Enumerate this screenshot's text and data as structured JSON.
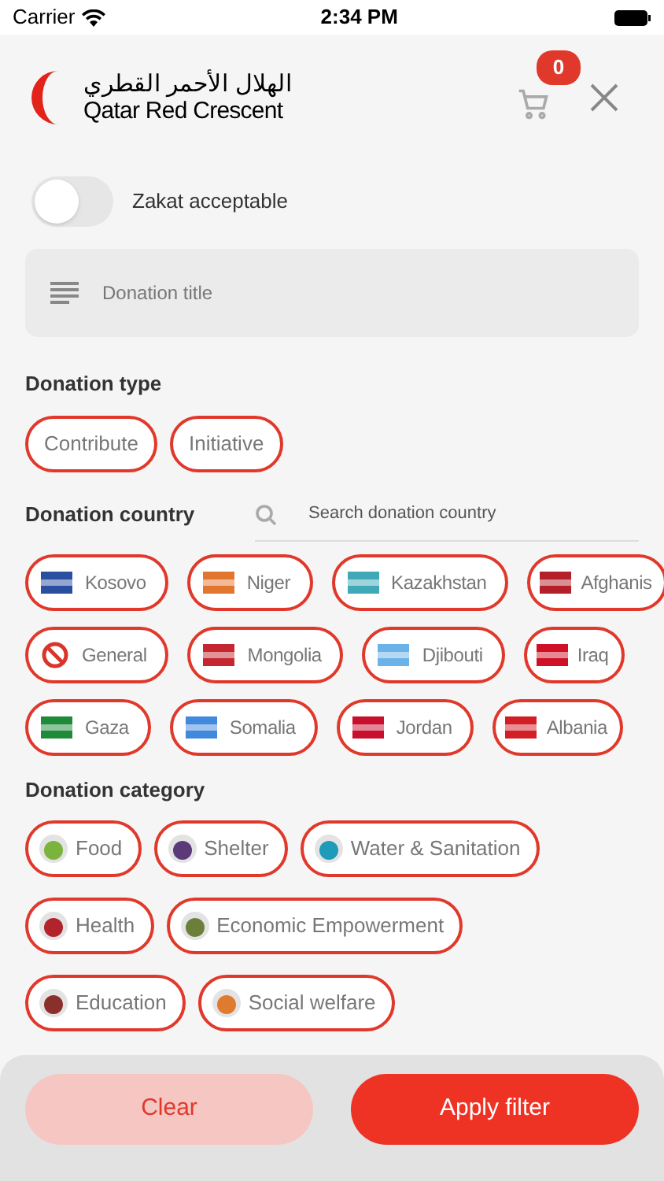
{
  "status_bar": {
    "carrier": "Carrier",
    "time": "2:34 PM"
  },
  "header": {
    "logo_arabic": "الهلال الأحمر القطري",
    "logo_english": "Qatar Red Crescent",
    "cart_count": "0"
  },
  "zakat": {
    "label": "Zakat acceptable",
    "on": false
  },
  "title_field": {
    "placeholder": "Donation title"
  },
  "donation_type": {
    "label": "Donation type",
    "options": [
      {
        "label": "Contribute"
      },
      {
        "label": "Initiative"
      }
    ]
  },
  "donation_country": {
    "label": "Donation country",
    "search": {
      "placeholder": "Search donation country"
    },
    "rows": [
      [
        {
          "label": "Kosovo",
          "kind": "flag",
          "color": "#2a4ea0"
        },
        {
          "label": "Niger",
          "kind": "flag",
          "color": "#e2762e"
        },
        {
          "label": "Kazakhstan",
          "kind": "flag",
          "color": "#3fa9b8"
        },
        {
          "label": "Afghanis",
          "kind": "flag",
          "color": "#b3202a"
        }
      ],
      [
        {
          "label": "General",
          "kind": "prohibited",
          "color": "#d9362b"
        },
        {
          "label": "Mongolia",
          "kind": "flag",
          "color": "#c4272f"
        },
        {
          "label": "Djibouti",
          "kind": "flag",
          "color": "#6ab2e7"
        },
        {
          "label": "Iraq",
          "kind": "flag",
          "color": "#ce1126"
        }
      ],
      [
        {
          "label": "Gaza",
          "kind": "flag",
          "color": "#1f8a3a"
        },
        {
          "label": "Somalia",
          "kind": "flag",
          "color": "#4189dd"
        },
        {
          "label": "Jordan",
          "kind": "flag",
          "color": "#c8102e"
        },
        {
          "label": "Albania",
          "kind": "flag",
          "color": "#d21f26"
        }
      ]
    ]
  },
  "donation_category": {
    "label": "Donation category",
    "rows": [
      [
        {
          "label": "Food",
          "color": "#7ab43c"
        },
        {
          "label": "Shelter",
          "color": "#5b3a7a"
        },
        {
          "label": "Water & Sanitation",
          "color": "#1e9bb8"
        }
      ],
      [
        {
          "label": "Health",
          "color": "#b2232b"
        },
        {
          "label": "Economic Empowerment",
          "color": "#6b7f3a"
        }
      ],
      [
        {
          "label": "Education",
          "color": "#8b2f2a"
        },
        {
          "label": "Social welfare",
          "color": "#e07a2e"
        }
      ]
    ]
  },
  "buttons": {
    "clear": "Clear",
    "apply": "Apply filter"
  }
}
